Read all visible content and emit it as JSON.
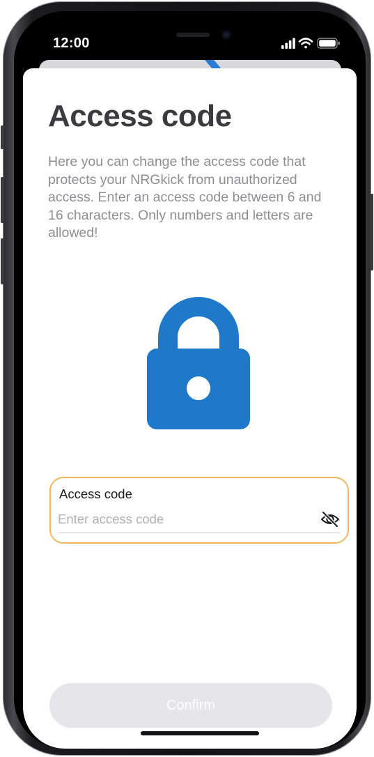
{
  "status_bar": {
    "time": "12:00",
    "icons": [
      "cellular-signal-icon",
      "wifi-icon",
      "battery-icon"
    ]
  },
  "page": {
    "title": "Access code",
    "description": "Here you can change the access code that protects your NRGkick from unauthorized access. Enter an access code between 6 and 16 characters. Only numbers and letters are allowed!"
  },
  "lock": {
    "icon": "lock-icon",
    "color": "#1f78c8"
  },
  "field": {
    "label": "Access code",
    "value": "",
    "placeholder": "Enter access code",
    "toggle_icon": "eye-slash-icon",
    "border_color": "#f0b85a"
  },
  "confirm": {
    "label": "Confirm",
    "state": "disabled"
  },
  "colors": {
    "accent": "#1f78c8",
    "title_text": "#3b3b3f",
    "description_text": "#8e8e93",
    "button_disabled": "#e5e5ea"
  }
}
